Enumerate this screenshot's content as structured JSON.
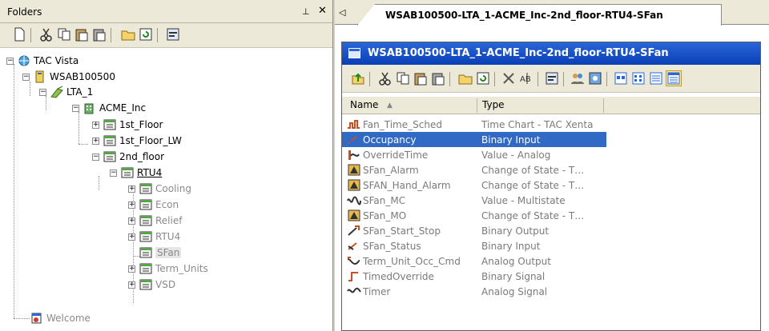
{
  "folders_pane": {
    "title": "Folders",
    "pin_glyph": "⊥",
    "close_glyph": "✕"
  },
  "tree": {
    "items": [
      {
        "label": "TAC Vista",
        "icon": "tac-vista-icon",
        "expander": "−"
      },
      {
        "label": "WSAB100500",
        "icon": "server-icon",
        "expander": "−"
      },
      {
        "label": "LTA_1",
        "icon": "lta-icon",
        "expander": "−"
      },
      {
        "label": "ACME_Inc",
        "icon": "building-icon",
        "expander": "−"
      },
      {
        "label": "1st_Floor",
        "icon": "folder-grid-icon",
        "expander": "+"
      },
      {
        "label": "1st_Floor_LW",
        "icon": "folder-grid-icon",
        "expander": "+"
      },
      {
        "label": "2nd_floor",
        "icon": "folder-grid-icon",
        "expander": "−"
      },
      {
        "label": "RTU4",
        "icon": "folder-grid-icon",
        "expander": "−"
      },
      {
        "label": "Cooling",
        "icon": "folder-grid-icon",
        "expander": "+"
      },
      {
        "label": "Econ",
        "icon": "folder-grid-icon",
        "expander": "+"
      },
      {
        "label": "Relief",
        "icon": "folder-grid-icon",
        "expander": "+"
      },
      {
        "label": "RTU4",
        "icon": "folder-grid-icon",
        "expander": "+"
      },
      {
        "label": "SFan",
        "icon": "folder-grid-icon",
        "expander": ""
      },
      {
        "label": "Term_Units",
        "icon": "folder-grid-icon",
        "expander": "+"
      },
      {
        "label": "VSD",
        "icon": "folder-grid-icon",
        "expander": "+"
      },
      {
        "label": "Welcome",
        "icon": "welcome-icon",
        "expander": ""
      }
    ]
  },
  "tab": {
    "arrow_glyph": "◁",
    "label": "WSAB100500-LTA_1-ACME_Inc-2nd_floor-RTU4-SFan"
  },
  "window": {
    "title": "WSAB100500-LTA_1-ACME_Inc-2nd_floor-RTU4-SFan"
  },
  "list": {
    "columns": {
      "name": "Name",
      "type": "Type",
      "sort_glyph": "▲"
    },
    "rows": [
      {
        "name": "Fan_Time_Sched",
        "type": "Time Chart - TAC Xenta",
        "icon": "time-chart-icon"
      },
      {
        "name": "Occupancy",
        "type": "Binary Input",
        "icon": "binary-input-icon"
      },
      {
        "name": "OverrideTime",
        "type": "Value - Analog",
        "icon": "analog-value-icon"
      },
      {
        "name": "SFan_Alarm",
        "type": "Change of State - T…",
        "icon": "alarm-icon"
      },
      {
        "name": "SFAN_Hand_Alarm",
        "type": "Change of State - T…",
        "icon": "alarm-icon"
      },
      {
        "name": "SFan_MC",
        "type": "Value - Multistate",
        "icon": "multistate-icon"
      },
      {
        "name": "SFan_MO",
        "type": "Change of State - T…",
        "icon": "alarm-icon"
      },
      {
        "name": "SFan_Start_Stop",
        "type": "Binary Output",
        "icon": "binary-output-icon"
      },
      {
        "name": "SFan_Status",
        "type": "Binary Input",
        "icon": "binary-input-icon"
      },
      {
        "name": "Term_Unit_Occ_Cmd",
        "type": "Analog Output",
        "icon": "analog-output-icon"
      },
      {
        "name": "TimedOverride",
        "type": "Binary Signal",
        "icon": "binary-signal-icon"
      },
      {
        "name": "Timer",
        "type": "Analog Signal",
        "icon": "analog-signal-icon"
      }
    ]
  },
  "colors": {
    "selection": "#316ac5",
    "title_bar": "#0a3fb6",
    "toolbar_bg": "#ece9d8"
  }
}
